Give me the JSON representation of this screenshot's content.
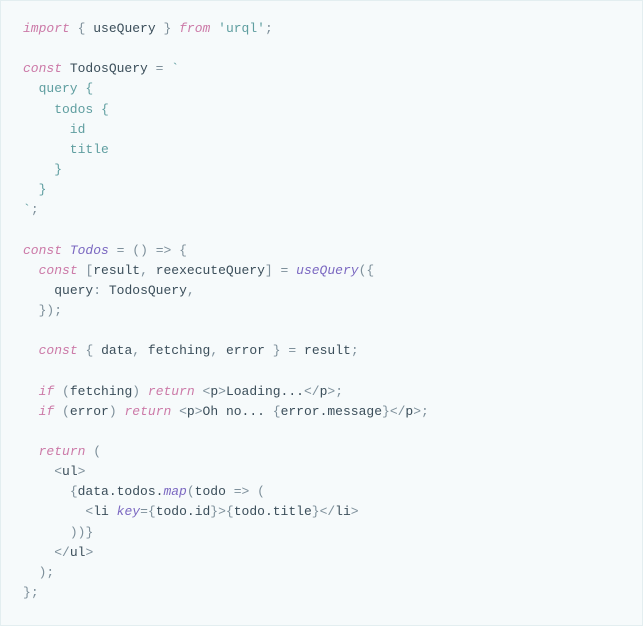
{
  "line1": {
    "import": "import",
    "lb": "{",
    "useQuery": "useQuery",
    "rb": "}",
    "from": "from",
    "q1": "'",
    "urql": "urql",
    "q2": "'",
    "semi": ";"
  },
  "line3": {
    "const": "const",
    "name": "TodosQuery",
    "eq": "=",
    "tick": "`"
  },
  "line4": {
    "txt": "  query {"
  },
  "line5": {
    "txt": "    todos {"
  },
  "line6": {
    "txt": "      id"
  },
  "line7": {
    "txt": "      title"
  },
  "line8": {
    "txt": "    }"
  },
  "line9": {
    "txt": "  }"
  },
  "line10": {
    "tick": "`",
    "semi": ";"
  },
  "line12": {
    "const": "const",
    "name": "Todos",
    "eq": "=",
    "lp": "(",
    "rp": ")",
    "arrow": "=>",
    "lb": "{"
  },
  "line13": {
    "const": "const",
    "lb": "[",
    "result": "result",
    "comma": ",",
    "reexec": "reexecuteQuery",
    "rb": "]",
    "eq": "=",
    "useQuery": "useQuery",
    "lp": "(",
    "lcb": "{"
  },
  "line14": {
    "key": "query",
    "colon": ":",
    "val": "TodosQuery",
    "comma": ","
  },
  "line15": {
    "rcb": "}",
    "rp": ")",
    "semi": ";"
  },
  "line17": {
    "const": "const",
    "lb": "{",
    "data": "data",
    "c1": ",",
    "fetching": "fetching",
    "c2": ",",
    "error": "error",
    "rb": "}",
    "eq": "=",
    "result": "result",
    "semi": ";"
  },
  "line19": {
    "if": "if",
    "lp": "(",
    "cond": "fetching",
    "rp": ")",
    "return": "return",
    "ot": "<",
    "tag": "p",
    "ct": ">",
    "txt": "Loading...",
    "ot2": "</",
    "tag2": "p",
    "ct2": ">",
    "semi": ";"
  },
  "line20": {
    "if": "if",
    "lp": "(",
    "cond": "error",
    "rp": ")",
    "return": "return",
    "ot": "<",
    "tag": "p",
    "ct": ">",
    "txt": "Oh no... ",
    "lb": "{",
    "expr": "error.message",
    "rb": "}",
    "ot2": "</",
    "tag2": "p",
    "ct2": ">",
    "semi": ";"
  },
  "line22": {
    "return": "return",
    "lp": "("
  },
  "line23": {
    "ot": "<",
    "tag": "ul",
    "ct": ">"
  },
  "line24": {
    "lb": "{",
    "obj": "data.todos.",
    "map": "map",
    "lp": "(",
    "arg": "todo",
    "arrow": "=>",
    "lp2": "("
  },
  "line25": {
    "ot": "<",
    "tag": "li",
    "attr": "key",
    "eq": "=",
    "lb": "{",
    "expr": "todo.id",
    "rb": "}",
    "ct": ">",
    "lb2": "{",
    "expr2": "todo.title",
    "rb2": "}",
    "ot2": "</",
    "tag2": "li",
    "ct2": ">"
  },
  "line26": {
    "rp": ")",
    "rp2": ")",
    "rb": "}"
  },
  "line27": {
    "ot": "</",
    "tag": "ul",
    "ct": ">"
  },
  "line28": {
    "rp": ")",
    "semi": ";"
  },
  "line29": {
    "rb": "}",
    "semi": ";"
  }
}
